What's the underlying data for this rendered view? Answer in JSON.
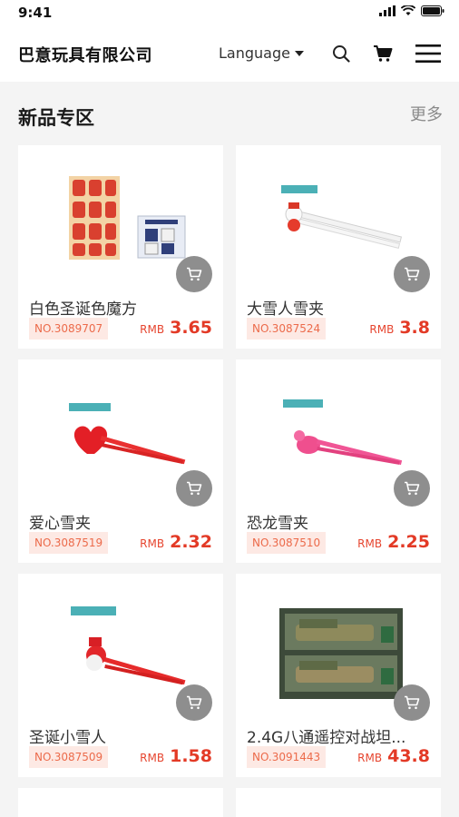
{
  "status": {
    "time": "9:41"
  },
  "header": {
    "brand": "巴意玩具有限公司",
    "language_label": "Language"
  },
  "section": {
    "title": "新品专区",
    "more": "更多"
  },
  "products": [
    {
      "name": "白色圣诞色魔方",
      "no": "NO.3089707",
      "currency": "RMB",
      "price": "3.65"
    },
    {
      "name": "大雪人雪夹",
      "no": "NO.3087524",
      "currency": "RMB",
      "price": "3.8"
    },
    {
      "name": "爱心雪夹",
      "no": "NO.3087519",
      "currency": "RMB",
      "price": "2.32"
    },
    {
      "name": "恐龙雪夹",
      "no": "NO.3087510",
      "currency": "RMB",
      "price": "2.25"
    },
    {
      "name": "圣诞小雪人",
      "no": "NO.3087509",
      "currency": "RMB",
      "price": "1.58"
    },
    {
      "name": "2.4G八通遥控对战坦...",
      "no": "NO.3091443",
      "currency": "RMB",
      "price": "43.8"
    }
  ],
  "icons": {
    "signal": "signal-icon",
    "wifi": "wifi-icon",
    "battery": "battery-icon",
    "search": "search-icon",
    "cart": "cart-icon",
    "menu": "menu-icon",
    "add_to_cart": "cart-icon"
  }
}
